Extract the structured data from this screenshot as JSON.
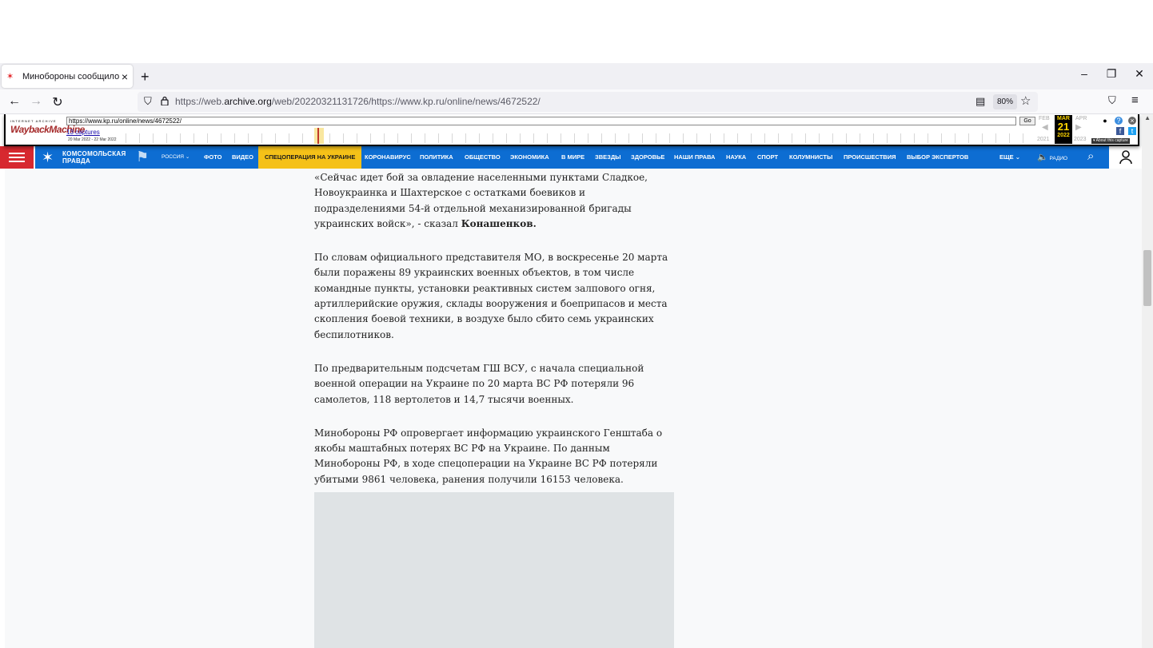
{
  "browser": {
    "tab_title": "Минобороны сообщило, что",
    "tab_favicon": "kp-favicon-icon",
    "url_prefix": "https://web.",
    "url_domain": "archive.org",
    "url_rest": "/web/20220321131726/https://www.kp.ru/online/news/4672522/",
    "zoom": "80%",
    "icons": [
      "back-icon",
      "forward-icon",
      "reload-icon",
      "shield-icon",
      "lock-icon",
      "reader-icon",
      "star-icon",
      "pocket-icon",
      "menu-icon",
      "plus-icon",
      "minimize-icon",
      "restore-icon",
      "close-icon"
    ]
  },
  "wayback": {
    "logo_top": "INTERNET ARCHIVE",
    "logo": "WaybackMachine",
    "url_field": "https://www.kp.ru/online/news/4672522/",
    "go_label": "Go",
    "captures": "13 captures",
    "range": "20 Mar 2022 - 22 Mar 2022",
    "prev_month": "FEB",
    "cur_month": "MAR",
    "next_month": "APR",
    "cur_day": "21",
    "prev_year": "2021",
    "cur_year": "2022",
    "next_year": "2023",
    "about": "About this capture",
    "accent": "#ffd700"
  },
  "site": {
    "logo_line1": "КОМСОМОЛЬСКАЯ",
    "logo_line2": "ПРАВДА",
    "region": "РОССИЯ",
    "nav": [
      "ФОТО",
      "ВИДЕО",
      "СПЕЦОПЕРАЦИЯ НА УКРАИНЕ",
      "КОРОНАВИРУС",
      "ПОЛИТИКА",
      "ОБЩЕСТВО",
      "ЭКОНОМИКА",
      "В МИРЕ",
      "ЗВЕЗДЫ",
      "ЗДОРОВЬЕ",
      "НАШИ ПРАВА",
      "НАУКА",
      "СПОРТ",
      "КОЛУМНИСТЫ",
      "ПРОИСШЕСТВИЯ",
      "ВЫБОР ЭКСПЕРТОВ"
    ],
    "more": "ЕЩЕ",
    "radio": "РАДИО",
    "brand_blue": "#0d6dd2",
    "brand_red": "#d7282f",
    "highlight": "#f5c118"
  },
  "article": {
    "p1": "«Сейчас идет бой за овладение населенными пунктами Сладкое, Новоукраинка и Шахтерское с остатками боевиков и подразделениями 54-й отдельной механизированной бригады украинских войск», - сказал",
    "p1_bold": "Конашенков.",
    "p2": "По словам официального представителя МО, в воскресенье 20 марта были поражены 89 украинских военных объектов, в том числе командные пункты, установки реактивных систем залпового огня, артиллерийские оружия, склады вооружения и боеприпасов и места скопления боевой техники, в воздухе было сбито семь украинских беспилотников.",
    "p3": "По предварительным подсчетам ГШ ВСУ, с начала специальной военной операции на Украине по 20 марта ВС РФ потеряли 96 самолетов, 118 вертолетов и 14,7 тысячи военных.",
    "p4": "Минобороны РФ опровергает информацию украинского Генштаба о якобы маштабных потерях ВС РФ на Украине. По данным Минобороны РФ, в ходе спецоперации на Украине ВС РФ потеряли убитыми 9861 человека, ранения получили 16153 человека."
  }
}
